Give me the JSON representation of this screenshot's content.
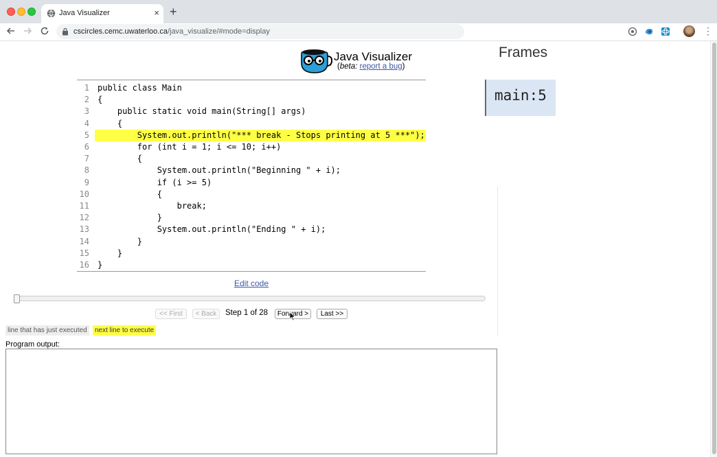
{
  "browser": {
    "tab_title": "Java Visualizer",
    "url_host": "cscircles.cemc.uwaterloo.ca",
    "url_path": "/java_visualize/#mode=display",
    "new_tab_glyph": "+",
    "close_glyph": "×"
  },
  "header": {
    "title": "Java Visualizer",
    "beta_label": "beta:",
    "report_link": "report a bug",
    "open_paren": "(",
    "close_paren": ")"
  },
  "code": {
    "highlight_line": 5,
    "lines": [
      {
        "n": "1",
        "text": "public class Main"
      },
      {
        "n": "2",
        "text": "{"
      },
      {
        "n": "3",
        "text": "    public static void main(String[] args)"
      },
      {
        "n": "4",
        "text": "    {"
      },
      {
        "n": "5",
        "text": "        System.out.println(\"*** break - Stops printing at 5 ***\");"
      },
      {
        "n": "6",
        "text": "        for (int i = 1; i <= 10; i++)"
      },
      {
        "n": "7",
        "text": "        {"
      },
      {
        "n": "8",
        "text": "            System.out.println(\"Beginning \" + i);"
      },
      {
        "n": "9",
        "text": "            if (i >= 5)"
      },
      {
        "n": "10",
        "text": "            {"
      },
      {
        "n": "11",
        "text": "                break;"
      },
      {
        "n": "12",
        "text": "            }"
      },
      {
        "n": "13",
        "text": "            System.out.println(\"Ending \" + i);"
      },
      {
        "n": "14",
        "text": "        }"
      },
      {
        "n": "15",
        "text": "    }"
      },
      {
        "n": "16",
        "text": "}"
      }
    ]
  },
  "controls": {
    "edit_code": "Edit code",
    "first": "<< First",
    "back": "< Back",
    "step_text": "Step 1 of 28",
    "forward": "Forward >",
    "last": "Last >>",
    "step_current": 1,
    "step_total": 28
  },
  "legend": {
    "prev_line": "line that has just executed",
    "next_line": "next line to execute"
  },
  "output": {
    "label": "Program output:",
    "text": ""
  },
  "frames": {
    "title": "Frames",
    "items": [
      {
        "name": "main:5"
      }
    ]
  },
  "colors": {
    "highlight": "#ffff46",
    "link": "#3d58a2",
    "frame_bg": "#dbe6f4"
  },
  "icons": [
    "globe-icon",
    "lock-icon",
    "back-arrow-icon",
    "forward-arrow-icon",
    "reload-icon",
    "extension-icon",
    "avatar",
    "menu-icon",
    "java-visualizer-logo",
    "cursor-icon"
  ]
}
